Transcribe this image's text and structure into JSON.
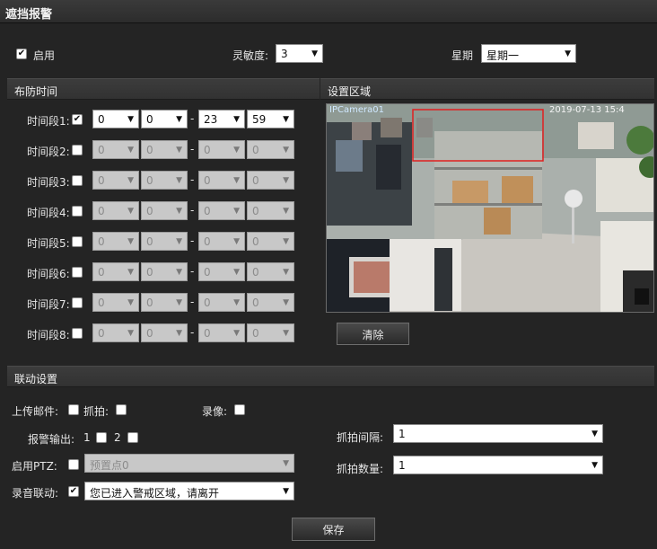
{
  "window": {
    "title": "遮挡报警"
  },
  "top": {
    "enable_label": "启用",
    "sensitivity_label": "灵敏度:",
    "sensitivity_value": "3",
    "weekday_label": "星期",
    "weekday_value": "星期一"
  },
  "schedule": {
    "title": "布防时间",
    "periods": [
      {
        "label": "时间段1:",
        "checked": true,
        "start_h": "0",
        "start_m": "0",
        "end_h": "23",
        "end_m": "59"
      },
      {
        "label": "时间段2:",
        "checked": false,
        "start_h": "0",
        "start_m": "0",
        "end_h": "0",
        "end_m": "0"
      },
      {
        "label": "时间段3:",
        "checked": false,
        "start_h": "0",
        "start_m": "0",
        "end_h": "0",
        "end_m": "0"
      },
      {
        "label": "时间段4:",
        "checked": false,
        "start_h": "0",
        "start_m": "0",
        "end_h": "0",
        "end_m": "0"
      },
      {
        "label": "时间段5:",
        "checked": false,
        "start_h": "0",
        "start_m": "0",
        "end_h": "0",
        "end_m": "0"
      },
      {
        "label": "时间段6:",
        "checked": false,
        "start_h": "0",
        "start_m": "0",
        "end_h": "0",
        "end_m": "0"
      },
      {
        "label": "时间段7:",
        "checked": false,
        "start_h": "0",
        "start_m": "0",
        "end_h": "0",
        "end_m": "0"
      },
      {
        "label": "时间段8:",
        "checked": false,
        "start_h": "0",
        "start_m": "0",
        "end_h": "0",
        "end_m": "0"
      }
    ],
    "separator": "-"
  },
  "region": {
    "title": "设置区域",
    "camera_label": "IPCamera01",
    "timestamp": "2019-07-13 15:4",
    "clear_button": "清除"
  },
  "linkage": {
    "title": "联动设置",
    "upload_email": "上传邮件:",
    "snapshot": "抓拍:",
    "record": "录像:",
    "alarm_output": "报警输出:",
    "output_1": "1",
    "output_2": "2",
    "enable_ptz": "启用PTZ:",
    "preset_value": "预置点0",
    "audio_linkage": "录音联动:",
    "audio_value": "您已进入警戒区域，请离开",
    "snap_interval_label": "抓拍间隔:",
    "snap_interval_value": "1",
    "snap_count_label": "抓拍数量:",
    "snap_count_value": "1"
  },
  "footer": {
    "save_button": "保存"
  },
  "colors": {
    "background": "#242424",
    "section": "#353535",
    "region_box": "#e02020"
  }
}
